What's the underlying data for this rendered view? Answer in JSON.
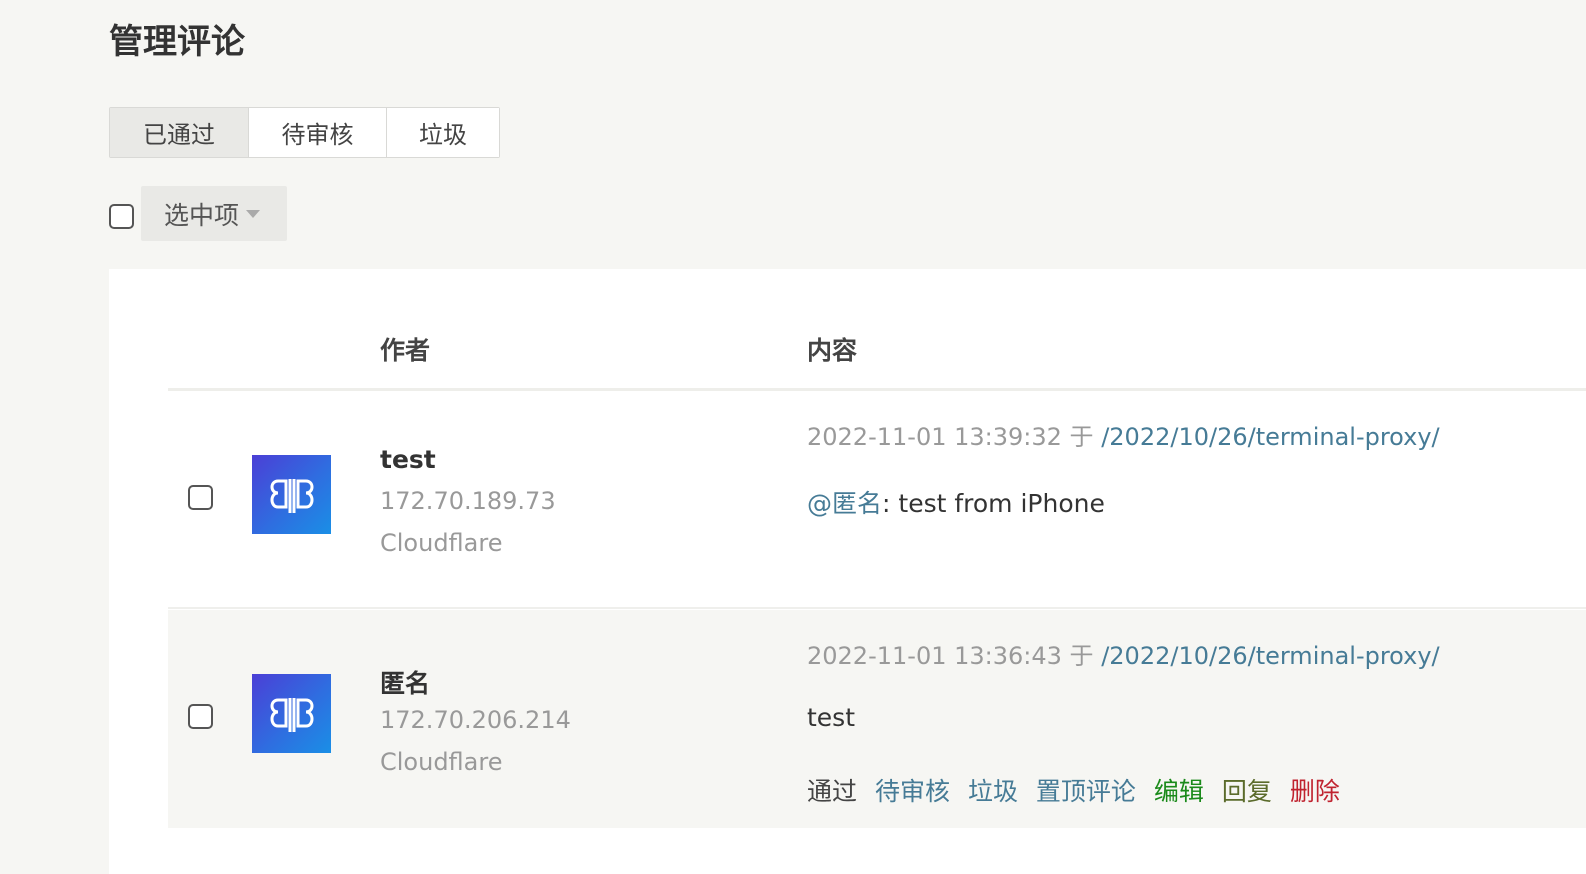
{
  "page": {
    "title": "管理评论"
  },
  "filter_tabs": [
    {
      "label": "已通过",
      "active": true
    },
    {
      "label": "待审核",
      "active": false
    },
    {
      "label": "垃圾",
      "active": false
    }
  ],
  "bulk": {
    "label": "选中项"
  },
  "table": {
    "headers": {
      "author": "作者",
      "content": "内容"
    },
    "rows": [
      {
        "author": "test",
        "ip": "172.70.189.73",
        "location": "Cloudflare",
        "date": "2022-11-01 13:39:32",
        "at": "于",
        "link": "/2022/10/26/terminal-proxy/",
        "mention": "@匿名",
        "text": ": test from iPhone"
      },
      {
        "author": "匿名",
        "ip": "172.70.206.214",
        "location": "Cloudflare",
        "date": "2022-11-01 13:36:43",
        "at": "于",
        "link": "/2022/10/26/terminal-proxy/",
        "text": "test",
        "actions": {
          "approve": "通过",
          "pending": "待审核",
          "spam": "垃圾",
          "pin": "置顶评论",
          "edit": "编辑",
          "reply": "回复",
          "delete": "删除"
        }
      }
    ]
  },
  "colors": {
    "link": "#467b96",
    "edit": "#1a8a1a",
    "reply": "#5b6b2b",
    "delete": "#c0232f",
    "avatar_start": "#4b3fd6",
    "avatar_end": "#1a8fe6"
  }
}
